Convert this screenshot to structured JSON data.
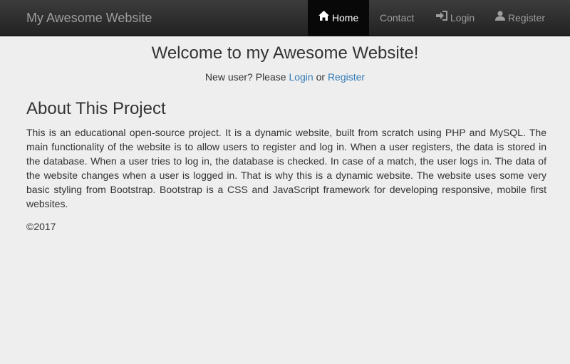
{
  "navbar": {
    "brand": "My Awesome Website",
    "items": [
      {
        "label": "Home",
        "icon": "home-icon",
        "active": true
      },
      {
        "label": "Contact",
        "icon": null,
        "active": false
      },
      {
        "label": "Login",
        "icon": "login-icon",
        "active": false
      },
      {
        "label": "Register",
        "icon": "user-icon",
        "active": false
      }
    ]
  },
  "hero": {
    "title": "Welcome to my Awesome Website!",
    "prompt": "New user? Please",
    "login_link": "Login",
    "or_text": "or",
    "register_link": "Register"
  },
  "about": {
    "title": "About This Project",
    "text": "This is an educational open-source project. It is a dynamic website, built from scratch using PHP and MySQL. The main functionality of the website is to allow users to register and log in. When a user registers, the data is stored in the database. When a user tries to log in, the database is checked. In case of a match, the user logs in. The data of the website changes when a user is logged in. That is why this is a dynamic website. The website uses some very basic styling from Bootstrap. Bootstrap is a CSS and JavaScript framework for developing responsive, mobile first websites."
  },
  "footer": {
    "copyright": "©2017"
  },
  "colors": {
    "navbar_bg": "#222222",
    "active_bg": "#080808",
    "link": "#337ab7",
    "page_bg": "#eeeeee"
  }
}
